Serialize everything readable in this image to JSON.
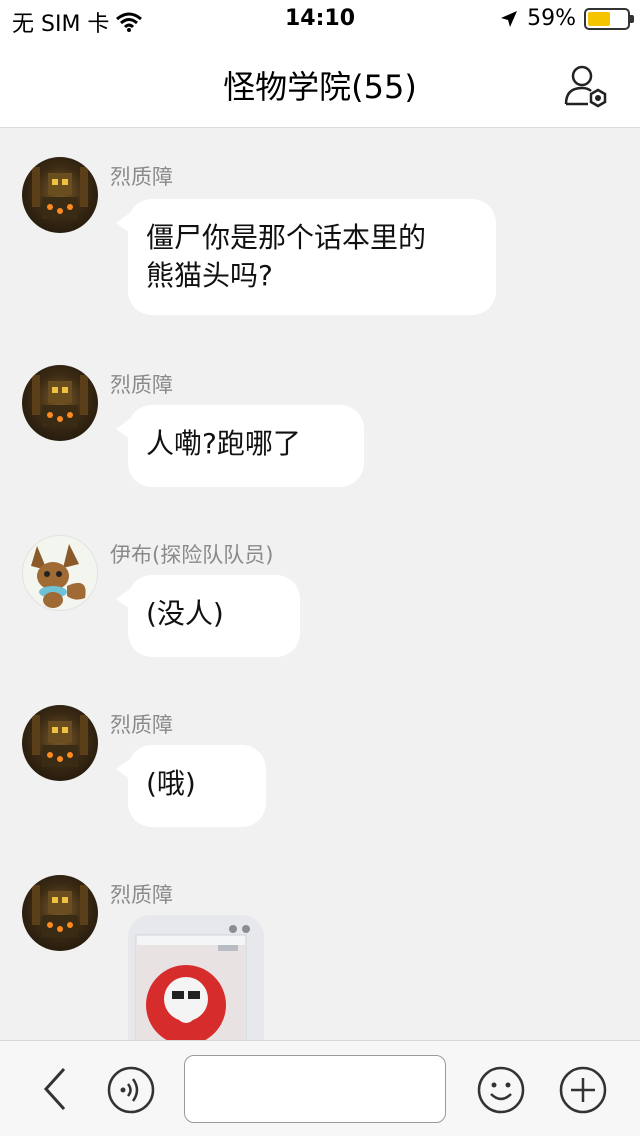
{
  "status_bar": {
    "carrier": "无 SIM 卡",
    "time": "14:10",
    "battery_percent": "59%",
    "battery_level": 0.59,
    "battery_color": "#f5c400"
  },
  "header": {
    "title": "怪物学院(55)",
    "right_icon": "group-settings-icon"
  },
  "messages": [
    {
      "sender": "烈质障",
      "avatar": "robot-avatar",
      "type": "text",
      "text_line1": "僵尸你是那个话本里的",
      "text_line2": "熊猫头吗?"
    },
    {
      "sender": "烈质障",
      "avatar": "robot-avatar",
      "type": "text",
      "text": "人嘞?跑哪了"
    },
    {
      "sender": "伊布(探险队队员)",
      "avatar": "eevee-avatar",
      "type": "text",
      "text": "(没人)"
    },
    {
      "sender": "烈质障",
      "avatar": "robot-avatar",
      "type": "text",
      "text": "(哦)"
    },
    {
      "sender": "烈质障",
      "avatar": "robot-avatar",
      "type": "image",
      "image": "sticker-image"
    }
  ],
  "bottom_bar": {
    "back_icon": "chevron-left-icon",
    "voice_icon": "voice-icon",
    "input_value": "",
    "emoji_icon": "emoji-icon",
    "plus_icon": "plus-icon"
  },
  "colors": {
    "background": "#f1f1f1",
    "bubble": "#ffffff",
    "sender_text": "#8a8a8a"
  }
}
